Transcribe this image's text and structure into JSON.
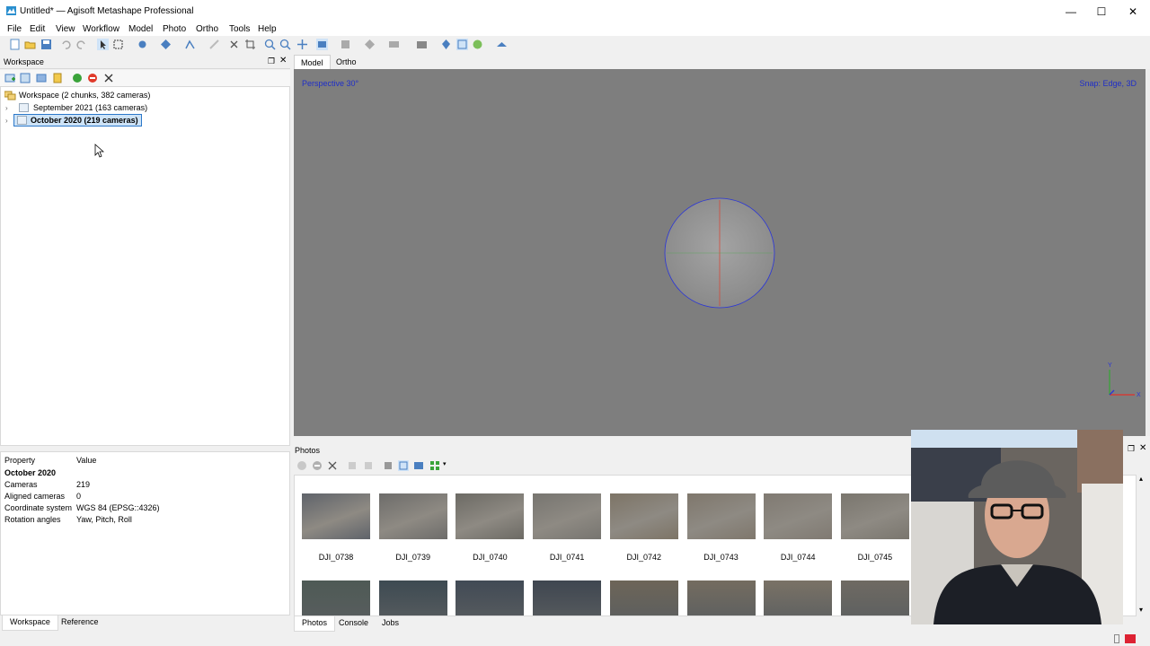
{
  "window": {
    "title": "Untitled* — Agisoft Metashape Professional",
    "controls": [
      "—",
      "☐",
      "✕"
    ]
  },
  "menu": [
    "File",
    "Edit",
    "View",
    "Workflow",
    "Model",
    "Photo",
    "Ortho",
    "Tools",
    "Help"
  ],
  "workspace": {
    "title": "Workspace",
    "root": "Workspace (2 chunks, 382 cameras)",
    "chunks": [
      {
        "label": "September 2021 (163 cameras)",
        "selected": false
      },
      {
        "label": "October 2020 (219 cameras)",
        "selected": true
      }
    ]
  },
  "properties": {
    "header_property": "Property",
    "header_value": "Value",
    "section": "October 2020",
    "rows": [
      {
        "k": "Cameras",
        "v": "219"
      },
      {
        "k": "Aligned cameras",
        "v": "0"
      },
      {
        "k": "Coordinate system",
        "v": "WGS 84 (EPSG::4326)"
      },
      {
        "k": "Rotation angles",
        "v": "Yaw, Pitch, Roll"
      }
    ]
  },
  "left_tabs": [
    "Workspace",
    "Reference"
  ],
  "view_tabs": [
    "Model",
    "Ortho"
  ],
  "viewport": {
    "perspective": "Perspective 30°",
    "snap": "Snap: Edge, 3D",
    "axis_y": "Y",
    "axis_x": "X",
    "background": "#7e7e7e",
    "accent": "#1f2ec8"
  },
  "photos": {
    "title": "Photos",
    "row1": [
      "DJI_0738",
      "DJI_0739",
      "DJI_0740",
      "DJI_0741",
      "DJI_0742",
      "DJI_0743",
      "DJI_0744",
      "DJI_0745"
    ]
  },
  "bottom_tabs": [
    "Photos",
    "Console",
    "Jobs"
  ]
}
